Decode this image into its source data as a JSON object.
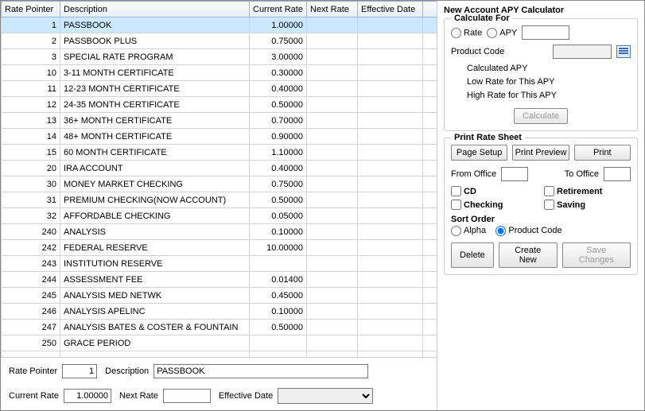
{
  "columns": [
    "Rate Pointer",
    "Description",
    "Current Rate",
    "Next Rate",
    "Effective Date",
    ""
  ],
  "rows": [
    {
      "rp": "1",
      "desc": "PASSBOOK",
      "cr": "1.00000",
      "nr": "",
      "ed": "",
      "selected": true
    },
    {
      "rp": "2",
      "desc": "PASSBOOK PLUS",
      "cr": "0.75000",
      "nr": "",
      "ed": ""
    },
    {
      "rp": "3",
      "desc": "SPECIAL RATE PROGRAM",
      "cr": "3.00000",
      "nr": "",
      "ed": ""
    },
    {
      "rp": "10",
      "desc": "3-11 MONTH CERTIFICATE",
      "cr": "0.30000",
      "nr": "",
      "ed": ""
    },
    {
      "rp": "11",
      "desc": "12-23 MONTH CERTIFICATE",
      "cr": "0.40000",
      "nr": "",
      "ed": ""
    },
    {
      "rp": "12",
      "desc": "24-35 MONTH CERTIFICATE",
      "cr": "0.50000",
      "nr": "",
      "ed": ""
    },
    {
      "rp": "13",
      "desc": "36+ MONTH CERTIFICATE",
      "cr": "0.70000",
      "nr": "",
      "ed": ""
    },
    {
      "rp": "14",
      "desc": "48+ MONTH CERTIFICATE",
      "cr": "0.90000",
      "nr": "",
      "ed": ""
    },
    {
      "rp": "15",
      "desc": "60 MONTH CERTIFICATE",
      "cr": "1.10000",
      "nr": "",
      "ed": ""
    },
    {
      "rp": "20",
      "desc": "IRA ACCOUNT",
      "cr": "0.40000",
      "nr": "",
      "ed": ""
    },
    {
      "rp": "30",
      "desc": "MONEY MARKET CHECKING",
      "cr": "0.75000",
      "nr": "",
      "ed": ""
    },
    {
      "rp": "31",
      "desc": "PREMIUM CHECKING(NOW ACCOUNT)",
      "cr": "0.50000",
      "nr": "",
      "ed": ""
    },
    {
      "rp": "32",
      "desc": "AFFORDABLE CHECKING",
      "cr": "0.05000",
      "nr": "",
      "ed": ""
    },
    {
      "rp": "240",
      "desc": "ANALYSIS",
      "cr": "0.10000",
      "nr": "",
      "ed": ""
    },
    {
      "rp": "242",
      "desc": "FEDERAL RESERVE",
      "cr": "10.00000",
      "nr": "",
      "ed": ""
    },
    {
      "rp": "243",
      "desc": "INSTITUTION RESERVE",
      "cr": "",
      "nr": "",
      "ed": ""
    },
    {
      "rp": "244",
      "desc": "ASSESSMENT FEE",
      "cr": "0.01400",
      "nr": "",
      "ed": ""
    },
    {
      "rp": "245",
      "desc": "ANALYSIS MED NETWK",
      "cr": "0.45000",
      "nr": "",
      "ed": ""
    },
    {
      "rp": "246",
      "desc": "ANALYSIS APELINC",
      "cr": "0.10000",
      "nr": "",
      "ed": ""
    },
    {
      "rp": "247",
      "desc": "ANALYSIS BATES & COSTER & FOUNTAIN",
      "cr": "0.50000",
      "nr": "",
      "ed": ""
    },
    {
      "rp": "250",
      "desc": "GRACE PERIOD",
      "cr": "",
      "nr": "",
      "ed": ""
    }
  ],
  "form": {
    "rate_pointer_label": "Rate Pointer",
    "rate_pointer_value": "1",
    "description_label": "Description",
    "description_value": "PASSBOOK",
    "current_rate_label": "Current Rate",
    "current_rate_value": "1.00000",
    "next_rate_label": "Next Rate",
    "next_rate_value": "",
    "effective_date_label": "Effective Date",
    "effective_date_value": ""
  },
  "apy": {
    "panel_title": "New Account APY Calculator",
    "calc_for_title": "Calculate For",
    "rate_label": "Rate",
    "apy_label": "APY",
    "product_code_label": "Product Code",
    "calculated_apy": "Calculated APY",
    "low_rate": "Low Rate for This APY",
    "high_rate": "High Rate for This APY",
    "calculate_btn": "Calculate"
  },
  "print": {
    "panel_title": "Print Rate Sheet",
    "page_setup": "Page Setup",
    "print_preview": "Print Preview",
    "print": "Print",
    "from_office": "From Office",
    "to_office": "To Office",
    "cd": "CD",
    "retirement": "Retirement",
    "checking": "Checking",
    "saving": "Saving",
    "sort_order": "Sort Order",
    "alpha": "Alpha",
    "product_code": "Product Code"
  },
  "actions": {
    "delete": "Delete",
    "create_new": "Create New",
    "save_changes": "Save Changes"
  }
}
